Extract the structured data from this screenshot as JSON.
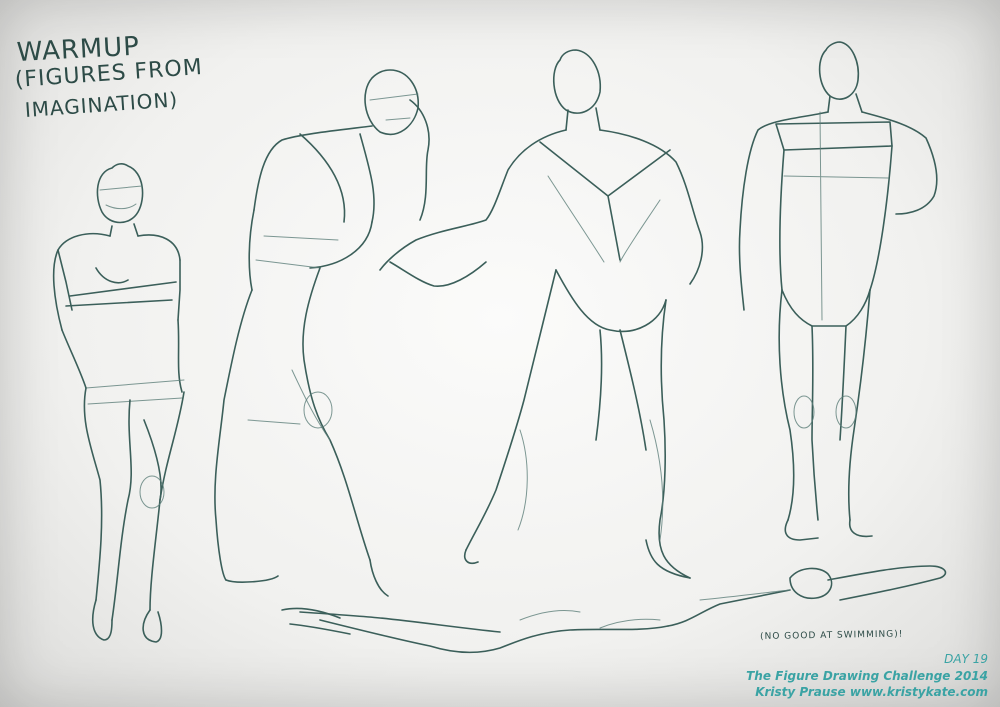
{
  "notes": {
    "title": "WARMUP",
    "subtitle_line1": "(FIGURES FROM",
    "subtitle_line2": "IMAGINATION)",
    "swim_note": "(NO GOOD AT SWIMMING)!"
  },
  "caption": {
    "day": "DAY 19",
    "challenge": "The Figure Drawing Challenge 2014",
    "author": "Kristy Prause www.kristykate.com"
  },
  "colors": {
    "ink": "#3b5f5a",
    "caption": "#3aa3a4",
    "paper": "#f2f2f0"
  }
}
